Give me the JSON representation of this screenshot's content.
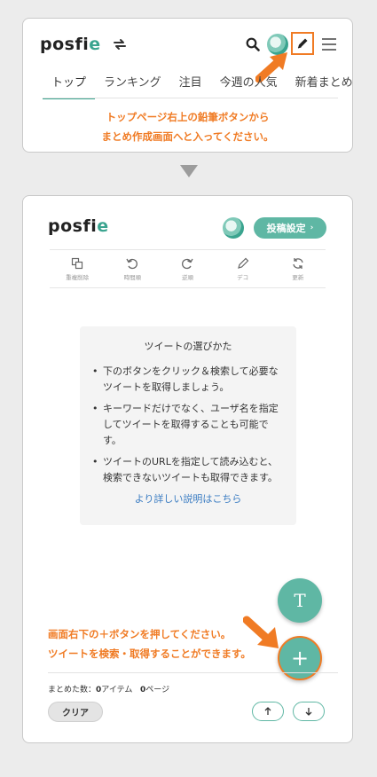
{
  "top_panel": {
    "logo": {
      "main": "posfi",
      "accent": "e"
    },
    "icons": [
      "sync-icon",
      "search-icon",
      "avatar",
      "pencil-icon",
      "menu-icon"
    ],
    "tabs": [
      {
        "label": "トップ",
        "active": true
      },
      {
        "label": "ランキング",
        "active": false
      },
      {
        "label": "注目",
        "active": false
      },
      {
        "label": "今週の人気",
        "active": false
      },
      {
        "label": "新着まとめ",
        "active": false
      }
    ],
    "note_line1": "トップページ右上の鉛筆ボタンから",
    "note_line2": "まとめ作成画面へと入ってください。"
  },
  "editor_panel": {
    "logo": {
      "main": "posfi",
      "accent": "e"
    },
    "settings_button": "投稿設定",
    "toolbar": [
      {
        "icon": "copy-icon",
        "label": "重複削除"
      },
      {
        "icon": "rotate-left-icon",
        "label": "時間順"
      },
      {
        "icon": "rotate-right-icon",
        "label": "逆順"
      },
      {
        "icon": "pencil-icon",
        "label": "デコ"
      },
      {
        "icon": "refresh-icon",
        "label": "更新"
      }
    ],
    "guide": {
      "title": "ツイートの選びかた",
      "bullets": [
        "下のボタンをクリック＆検索して必要なツイートを取得しましょう。",
        "キーワードだけでなく、ユーザ名を指定してツイートを取得することも可能です。",
        "ツイートのURLを指定して読み込むと、検索できないツイートも取得できます。"
      ],
      "more_link": "より詳しい説明はこちら"
    },
    "fab_text": "T",
    "fab_add": "+",
    "note_line1": "画面右下の＋ボタンを押してください。",
    "note_line2": "ツイートを検索・取得することができます。",
    "count": {
      "prefix": "まとめた数：",
      "items": "0",
      "items_unit": "アイテム",
      "pages": "0",
      "pages_unit": "ページ"
    },
    "clear_button": "クリア"
  },
  "colors": {
    "accent": "#5fb7a4",
    "annotation": "#f07b24",
    "link": "#3a7cc2"
  }
}
